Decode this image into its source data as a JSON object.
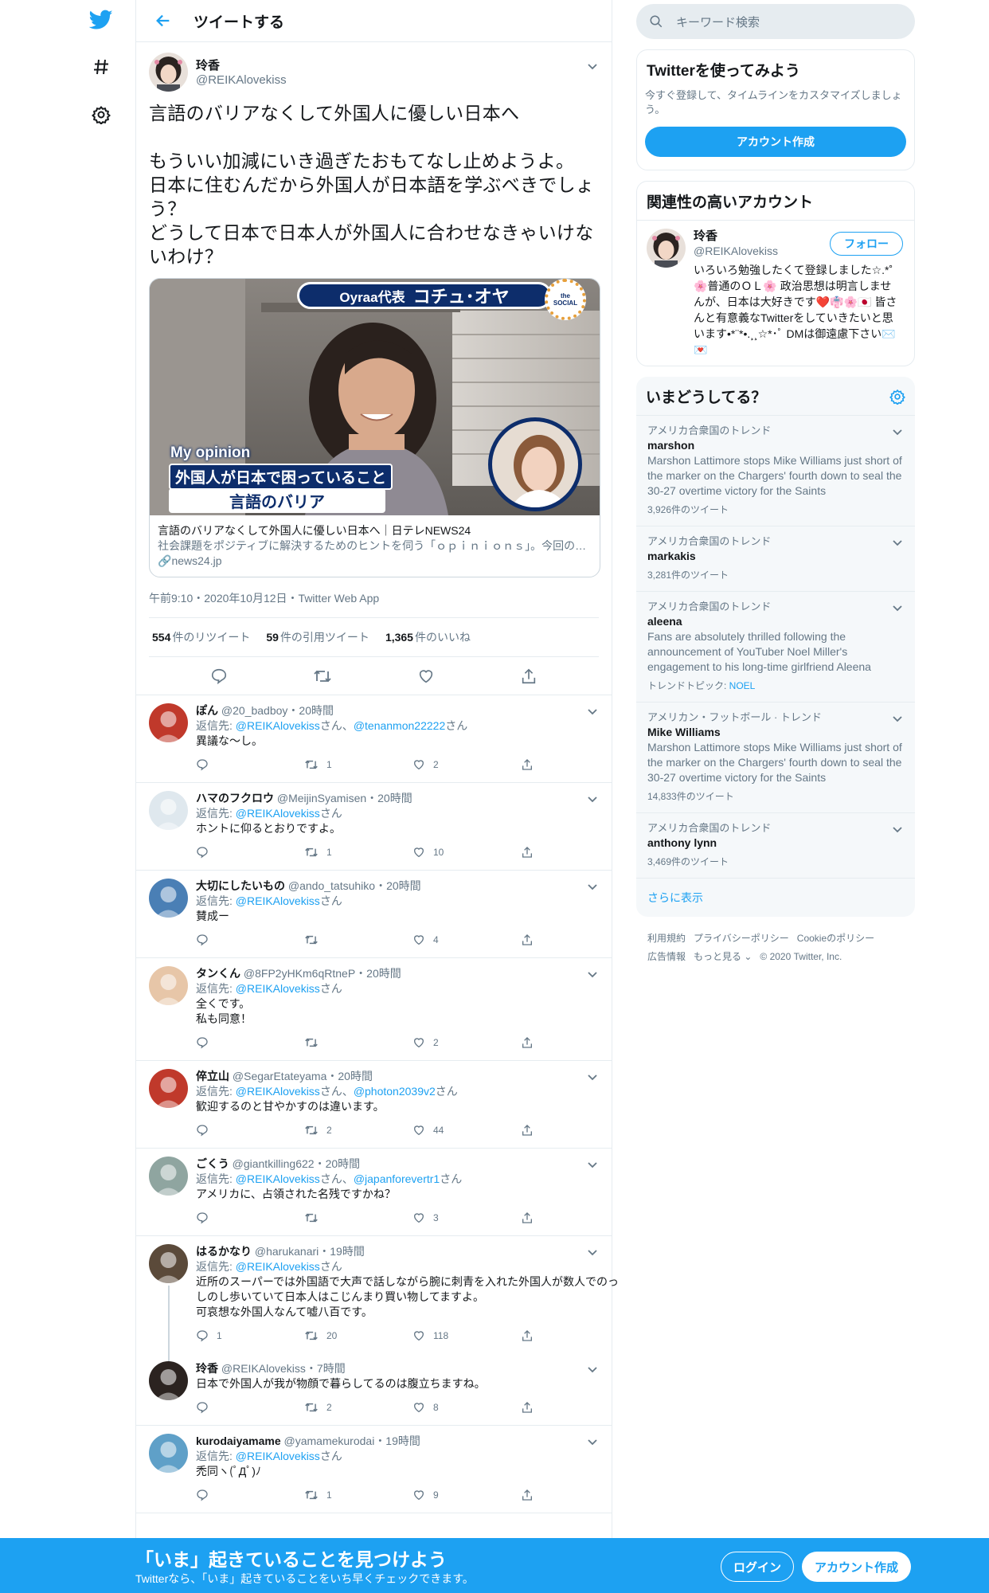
{
  "colors": {
    "accent": "#1da1f2",
    "text": "#14171a",
    "secondary": "#657786",
    "border": "#e6ecf0"
  },
  "header": {
    "title": "ツイートする"
  },
  "main_tweet": {
    "name": "玲香",
    "handle": "@REIKAlovekiss",
    "text": "言語のバリアなくして外国人に優しい日本へ\n\nもういい加減にいき過ぎたおもてなし止めようよ。\n日本に住むんだから外国人が日本語を学ぶべきでしょう？\nどうして日本で日本人が外国人に合わせなきゃいけないわけ？",
    "card": {
      "banner_role": "Oyraa代表",
      "banner_name": "コチュ･オヤ",
      "badge": "the SOCIAL",
      "overlay_1": "My opinion",
      "overlay_2": "外国人が日本で困っていること",
      "overlay_3": "言語のバリア",
      "title": "言語のバリアなくして外国人に優しい日本へ｜日テレNEWS24",
      "desc": "社会課題をポジティブに解決するためのヒントを伺う「ｏｐｉｎｉｏｎｓ」。今回の話題は「外国人が日本で困っていること」。通訳マッチングアプリ「Ｏｙｒａａ」",
      "link": "news24.jp"
    },
    "meta": "午前9:10・2020年10月12日・Twitter Web App",
    "stats": {
      "retweets_num": "554",
      "retweets_label": "件のリツイート",
      "quotes_num": "59",
      "quotes_label": "件の引用ツイート",
      "likes_num": "1,365",
      "likes_label": "件のいいね"
    }
  },
  "replies": [
    {
      "name": "ぽん",
      "handle": "@20_badboy",
      "time": "・20時間",
      "reply_prefix": "返信先: ",
      "reply_to": "@REIKAlovekiss",
      "reply_sep": "さん、",
      "reply_to2": "@tenanmon22222",
      "reply_suffix": "さん",
      "text": "異議な〜し。",
      "counts": {
        "reply": "",
        "retweet": "1",
        "like": "2"
      }
    },
    {
      "name": "ハマのフクロウ",
      "handle": "@MeijinSyamisen",
      "time": "・20時間",
      "reply_prefix": "返信先: ",
      "reply_to": "@REIKAlovekiss",
      "reply_sep": "",
      "reply_to2": "",
      "reply_suffix": "さん",
      "text": "ホントに仰るとおりですよ。",
      "counts": {
        "reply": "",
        "retweet": "1",
        "like": "10"
      }
    },
    {
      "name": "大切にしたいもの",
      "handle": "@ando_tatsuhiko",
      "time": "・20時間",
      "reply_prefix": "返信先: ",
      "reply_to": "@REIKAlovekiss",
      "reply_sep": "",
      "reply_to2": "",
      "reply_suffix": "さん",
      "text": "賛成ー",
      "counts": {
        "reply": "",
        "retweet": "",
        "like": "4"
      }
    },
    {
      "name": "タンくん",
      "handle": "@8FP2yHKm6qRtneP",
      "time": "・20時間",
      "reply_prefix": "返信先: ",
      "reply_to": "@REIKAlovekiss",
      "reply_sep": "",
      "reply_to2": "",
      "reply_suffix": "さん",
      "text": "全くです。\n私も同意！",
      "counts": {
        "reply": "",
        "retweet": "",
        "like": "2"
      }
    },
    {
      "name": "倅立山",
      "handle": "@SegarEtateyama",
      "time": "・20時間",
      "reply_prefix": "返信先: ",
      "reply_to": "@REIKAlovekiss",
      "reply_sep": "さん、",
      "reply_to2": "@photon2039v2",
      "reply_suffix": "さん",
      "text": "歓迎するのと甘やかすのは違います。",
      "counts": {
        "reply": "",
        "retweet": "2",
        "like": "44"
      }
    },
    {
      "name": "ごくう",
      "handle": "@giantkilling622",
      "time": "・20時間",
      "reply_prefix": "返信先: ",
      "reply_to": "@REIKAlovekiss",
      "reply_sep": "さん、",
      "reply_to2": "@japanforevertr1",
      "reply_suffix": "さん",
      "text": "アメリカに、占領された名残ですかね？",
      "counts": {
        "reply": "",
        "retweet": "",
        "like": "3"
      }
    },
    {
      "name": "はるかなり",
      "handle": "@harukanari",
      "time": "・19時間",
      "reply_prefix": "返信先: ",
      "reply_to": "@REIKAlovekiss",
      "reply_sep": "",
      "reply_to2": "",
      "reply_suffix": "さん",
      "text": "近所のスーパーでは外国語で大声で話しながら腕に刺青を入れた外国人が数人でのっしのし歩いていて日本人はこじんまり買い物してますよ。\n可哀想な外国人なんて嘘八百です。",
      "counts": {
        "reply": "1",
        "retweet": "20",
        "like": "118"
      }
    },
    {
      "name": "玲香",
      "handle": "@REIKAlovekiss",
      "time": "・7時間",
      "reply_prefix": "",
      "reply_to": "",
      "reply_sep": "",
      "reply_to2": "",
      "reply_suffix": "",
      "text": "日本で外国人が我が物顔で暮らしてるのは腹立ちますね。",
      "counts": {
        "reply": "",
        "retweet": "2",
        "like": "8"
      }
    },
    {
      "name": "kurodaiyamame",
      "handle": "@yamamekurodai",
      "time": "・19時間",
      "reply_prefix": "返信先: ",
      "reply_to": "@REIKAlovekiss",
      "reply_sep": "",
      "reply_to2": "",
      "reply_suffix": "さん",
      "text": "禿同ヽ(ﾟДﾟ)ﾉ",
      "counts": {
        "reply": "",
        "retweet": "1",
        "like": "9"
      }
    }
  ],
  "search": {
    "placeholder": "キーワード検索"
  },
  "signup_box": {
    "title": "Twitterを使ってみよう",
    "desc": "今すぐ登録して、タイムラインをカスタマイズしましょう。",
    "button": "アカウント作成"
  },
  "related": {
    "title": "関連性の高いアカウント",
    "name": "玲香",
    "handle": "@REIKAlovekiss",
    "follow": "フォロー",
    "bio": "いろいろ勉強したくて登録しました☆.*˚ 🌸普通のＯＬ🌸 政治思想は明言しませんが、日本は大好きです❤️👘🌸🇯🇵 皆さんと有意義なTwitterをしていきたいと思います•*¨*•.¸¸☆*･ﾟ DMは御遠慮下さい✉️💌"
  },
  "trends": {
    "title": "いまどうしてる？",
    "items": [
      {
        "context": "アメリカ合衆国のトレンド",
        "name": "marshon",
        "desc": "Marshon Lattimore stops Mike Williams just short of the marker on the Chargers' fourth down to seal the 30-27 overtime victory for the Saints",
        "topic_label": "",
        "topic": "",
        "count": "3,926件のツイート"
      },
      {
        "context": "アメリカ合衆国のトレンド",
        "name": "markakis",
        "desc": "",
        "topic_label": "",
        "topic": "",
        "count": "3,281件のツイート"
      },
      {
        "context": "アメリカ合衆国のトレンド",
        "name": "aleena",
        "desc": "Fans are absolutely thrilled following the announcement of YouTuber Noel Miller's engagement to his long-time girlfriend Aleena",
        "topic_label": "トレンドトピック: ",
        "topic": "NOEL",
        "count": ""
      },
      {
        "context": "アメリカン・フットボール · トレンド",
        "name": "Mike Williams",
        "desc": "Marshon Lattimore stops Mike Williams just short of the marker on the Chargers' fourth down to seal the 30-27 overtime victory for the Saints",
        "topic_label": "",
        "topic": "",
        "count": "14,833件のツイート"
      },
      {
        "context": "アメリカ合衆国のトレンド",
        "name": "anthony lynn",
        "desc": "",
        "topic_label": "",
        "topic": "",
        "count": "3,469件のツイート"
      }
    ],
    "more": "さらに表示"
  },
  "footer": {
    "terms": "利用規約",
    "privacy": "プライバシーポリシー",
    "cookies": "Cookieのポリシー",
    "ads": "広告情報",
    "more": "もっと見る ⌄",
    "copyright": "© 2020 Twitter, Inc."
  },
  "bottom_bar": {
    "title": "「いま」起きていることを見つけよう",
    "subtitle": "Twitterなら、「いま」起きていることをいち早くチェックできます。",
    "login": "ログイン",
    "signup": "アカウント作成"
  }
}
